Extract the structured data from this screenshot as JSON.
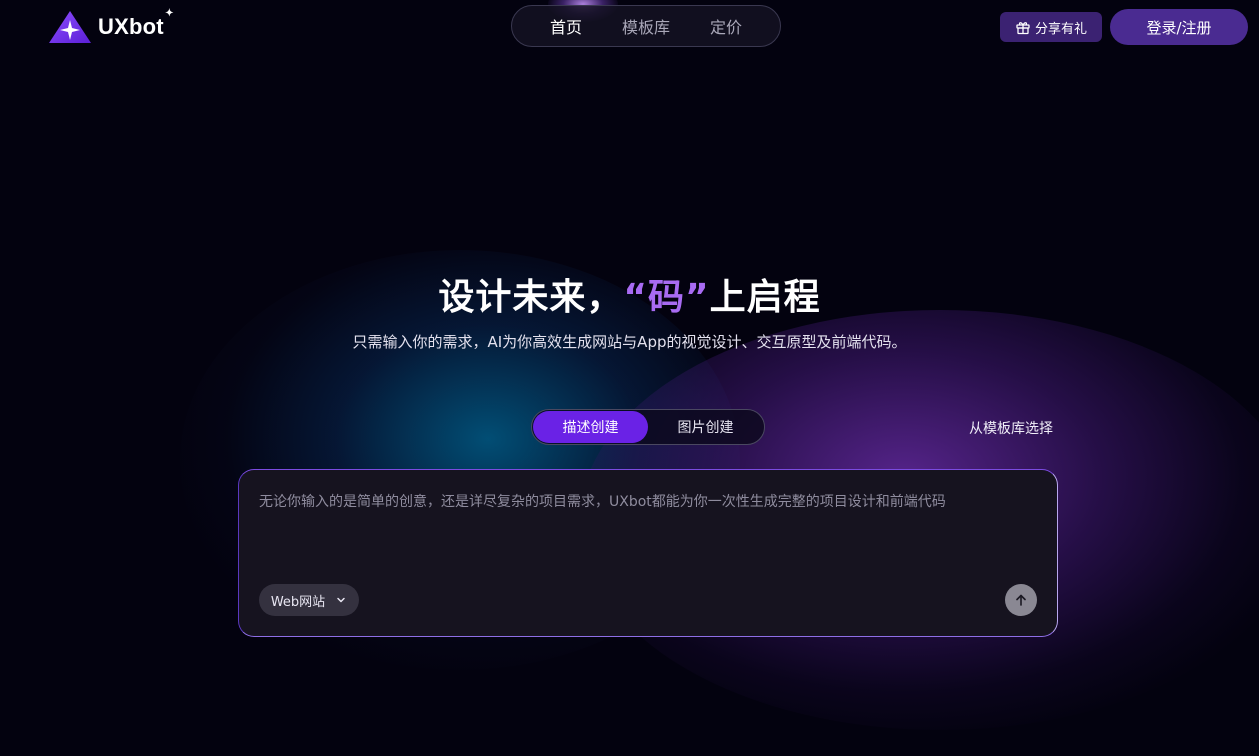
{
  "brand": {
    "name": "UXbot",
    "spark": "✦"
  },
  "nav": {
    "items": [
      {
        "label": "首页",
        "active": true
      },
      {
        "label": "模板库",
        "active": false
      },
      {
        "label": "定价",
        "active": false
      }
    ]
  },
  "header": {
    "share_label": "分享有礼",
    "login_label": "登录/注册"
  },
  "hero": {
    "title_main": "设计未来，",
    "title_accent": "“码”",
    "title_end": "上启程",
    "subtitle": "只需输入你的需求，AI为你高效生成网站与App的视觉设计、交互原型及前端代码。"
  },
  "mode_tabs": [
    {
      "label": "描述创建",
      "active": true
    },
    {
      "label": "图片创建",
      "active": false
    }
  ],
  "template_link": "从模板库选择",
  "prompt": {
    "value": "",
    "placeholder": "无论你输入的是简单的创意，还是详尽复杂的项目需求，UXbot都能为你一次性生成完整的项目设计和前端代码",
    "platform": "Web网站"
  },
  "colors": {
    "background": "#03020f",
    "accent": "#a86bf2",
    "tab_active": "#6a22e6",
    "login": "#4a2b91",
    "share": "#3b2272"
  }
}
